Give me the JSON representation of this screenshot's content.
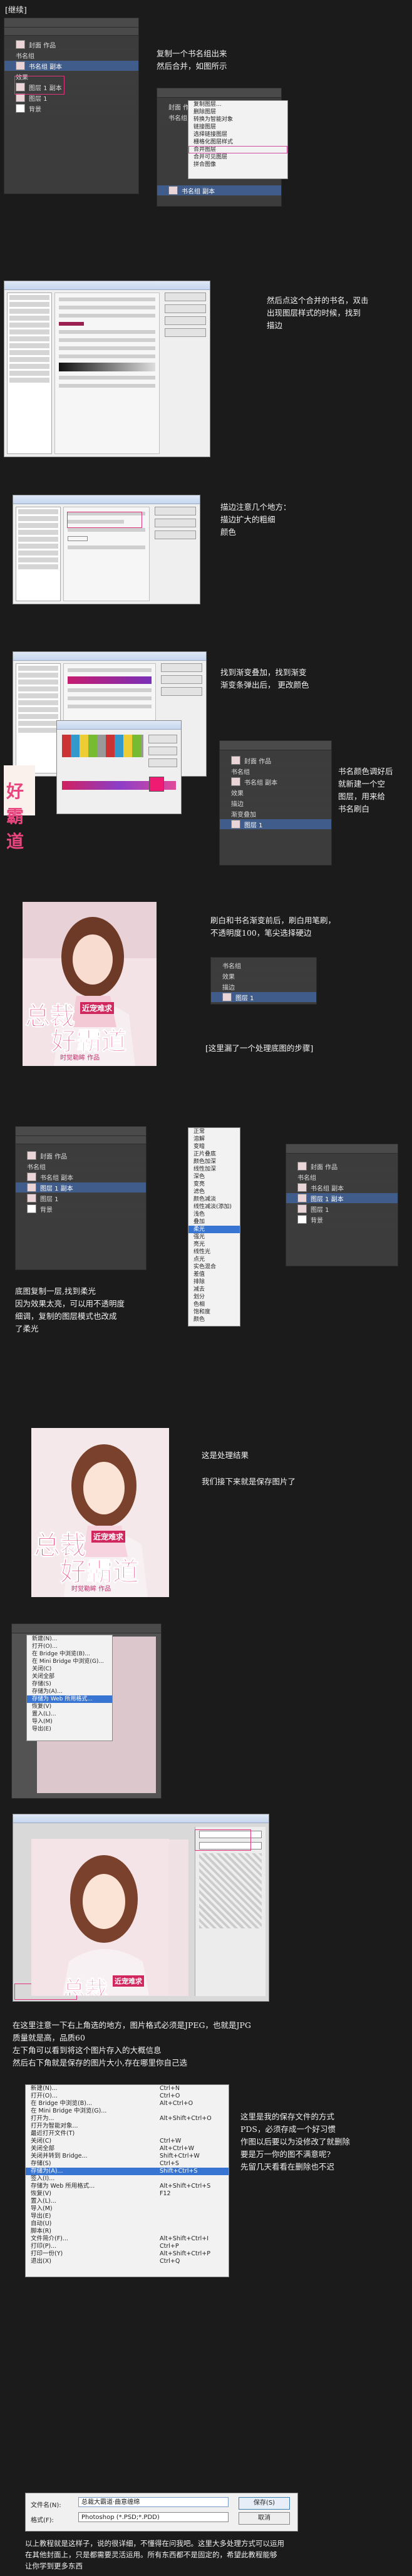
{
  "tag": "[继续]",
  "notes": {
    "n1": [
      "复制一个书名组出来",
      "然后合并，如图所示"
    ],
    "n2": [
      "然后点这个合并的书名，双击",
      "出现图层样式的时候，找到",
      "描边"
    ],
    "n3": [
      "描边注意几个地方：",
      "描边扩大的粗细",
      "颜色"
    ],
    "n4": [
      "找到渐变叠加，找到渐变",
      "渐变条弹出后，  更改颜色"
    ],
    "n5": [
      "书名颜色调好后",
      "就新建一个空",
      "图层，用来给",
      "书名刷白"
    ],
    "n6": [
      "刷白和书名渐变前后，刷白用笔刷，",
      "不透明度100，笔尖选择硬边"
    ],
    "n7": "[这里漏了一个处理底图的步骤]",
    "n8": [
      "底图复制一层,找到柔光",
      "因为效果太亮，可以用不透明度",
      "细调，复制的图层模式也改成",
      "了柔光"
    ],
    "n9": "这是处理结果",
    "n10": "我们接下来就是保存图片了",
    "n11": [
      "在这里注意一下右上角选的地方，图片格式必须是JPEG，也就是JPG",
      "质量就是高，品质60",
      "左下角可以看到将这个图片存入的大概信息",
      "然后右下角就是保存的图片大小,存在哪里你自己选"
    ],
    "n12": [
      "这里是我的保存文件的方式",
      "PDS，必须存成一个好习惯",
      "作图以后要以为没修改了就删除",
      "要是万一你的图不满意呢?",
      "先留几天看看在删除也不迟"
    ],
    "n13": [
      "以上教程就是这样子，说的很详细，不懂得在问我吧。这里大多处理方式可以运用",
      "在其他封面上，只是都需要灵活运用。所有东西都不是固定的，希望此教程能够",
      "让你学到更多东西"
    ]
  },
  "layers": {
    "merged": "书名组 副本",
    "group": "书名组",
    "bookname": "封面 作品",
    "fx": "效果",
    "stroke": "描边",
    "gradient": "渐变叠加",
    "bg": "背景",
    "layer1": "图层 1",
    "layer1copy": "图层 1 副本",
    "opacity": "100%",
    "fill": "100%"
  },
  "context_menu": [
    "复制图层...",
    "删除图层",
    "转换为智能对象",
    "链接图层",
    "选择链接图层",
    "栅格化图层样式",
    "合并图层",
    "合并可见图层",
    "拼合图像"
  ],
  "blend_menu": [
    "正常",
    "溶解",
    "变暗",
    "正片叠底",
    "颜色加深",
    "线性加深",
    "深色",
    "变亮",
    "滤色",
    "颜色减淡",
    "线性减淡(添加)",
    "浅色",
    "叠加",
    "柔光",
    "强光",
    "亮光",
    "线性光",
    "点光",
    "实色混合",
    "差值",
    "排除",
    "减去",
    "划分",
    "色相",
    "饱和度",
    "颜色",
    "明度"
  ],
  "file_menu": [
    "新建(N)...",
    "打开(O)...",
    "在 Bridge 中浏览(B)...",
    "在 Mini Bridge 中浏览(G)...",
    "打开为...",
    "打开为智能对象...",
    "最近打开文件(T)",
    "关闭(C)",
    "关闭全部",
    "关闭并转到 Bridge...",
    "存储(S)",
    "存储为(A)...",
    "签入(I)...",
    "存储为 Web 所用格式...",
    "恢复(V)",
    "置入(L)...",
    "导入(M)",
    "导出(E)",
    "自动(U)",
    "脚本(R)",
    "文件简介(F)...",
    "打印(P)...",
    "打印一份(Y)",
    "退出(X)"
  ],
  "file_shortcuts": [
    "Ctrl+N",
    "Ctrl+O",
    "Alt+Ctrl+O",
    "",
    "Alt+Shift+Ctrl+O",
    "",
    "",
    "Ctrl+W",
    "Alt+Ctrl+W",
    "Shift+Ctrl+W",
    "Ctrl+S",
    "Shift+Ctrl+S",
    "",
    "Alt+Shift+Ctrl+S",
    "F12",
    "",
    "",
    "",
    "",
    "",
    "Alt+Shift+Ctrl+I",
    "Ctrl+P",
    "Alt+Shift+Ctrl+P",
    "Ctrl+Q"
  ],
  "save_dialog": {
    "filename_label": "文件名(N):",
    "filename": "总裁大霸道·曲意缠绵",
    "format_label": "格式(F):",
    "format": "Photoshop (*.PSD;*.PDD)",
    "save_button": "保存(S)",
    "cancel_button": "取消"
  },
  "cover": {
    "title_line1": "总裁",
    "title_line2": "好霸道",
    "subtitle": "近宠难求",
    "author": "时觉勒眸 作品"
  },
  "colors": {
    "page_bg": "#1b1b1b",
    "ps_panel": "#535353",
    "selection": "#3f5c8a",
    "annotation": "#e0357c",
    "title_pink": "#e8457e"
  }
}
